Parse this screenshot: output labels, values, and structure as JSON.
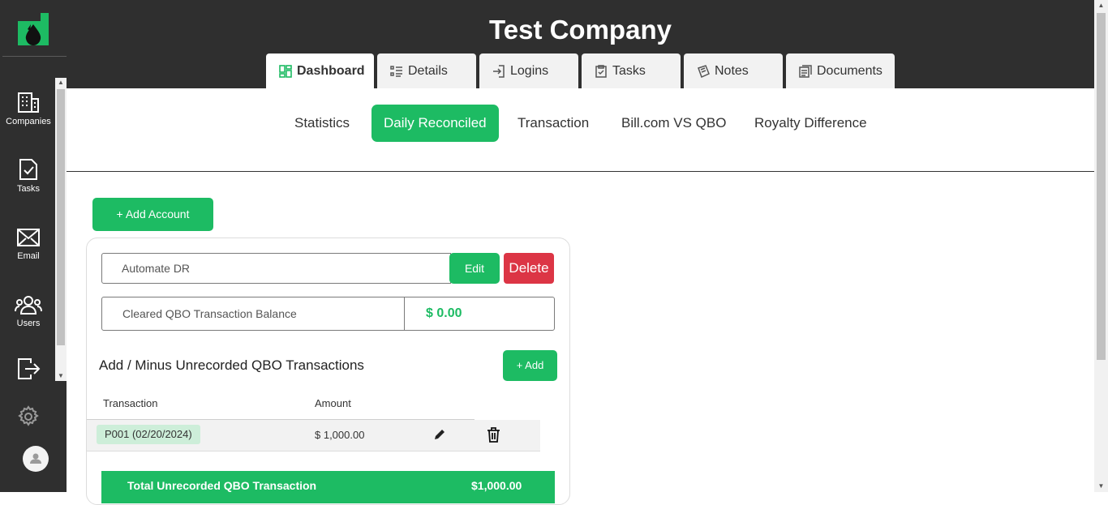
{
  "header": {
    "company_name": "Test Company"
  },
  "tabs": [
    {
      "label": "Dashboard",
      "icon": "dashboard-icon",
      "active": true
    },
    {
      "label": "Details",
      "icon": "list-icon"
    },
    {
      "label": "Logins",
      "icon": "login-icon"
    },
    {
      "label": "Tasks",
      "icon": "clipboard-icon"
    },
    {
      "label": "Notes",
      "icon": "notes-icon"
    },
    {
      "label": "Documents",
      "icon": "documents-icon"
    }
  ],
  "sidebar": {
    "items": [
      {
        "label": "Companies",
        "icon": "building-icon"
      },
      {
        "label": "Tasks",
        "icon": "task-icon"
      },
      {
        "label": "Email",
        "icon": "email-icon"
      },
      {
        "label": "Users",
        "icon": "users-icon"
      },
      {
        "label": "",
        "icon": "logout-icon"
      },
      {
        "label": "",
        "icon": "gear-icon"
      }
    ]
  },
  "subtabs": [
    {
      "label": "Statistics"
    },
    {
      "label": "Daily Reconciled",
      "active": true
    },
    {
      "label": "Transaction"
    },
    {
      "label": "Bill.com VS QBO"
    },
    {
      "label": "Royalty Difference"
    }
  ],
  "actions": {
    "add_account": "+ Add Account"
  },
  "account": {
    "name": "Automate DR",
    "edit": "Edit",
    "delete": "Delete",
    "balance_label": "Cleared QBO Transaction Balance",
    "balance_value": "$ 0.00"
  },
  "unrecorded": {
    "title": "Add / Minus Unrecorded QBO Transactions",
    "add": "+ Add",
    "columns": [
      "Transaction",
      "Amount"
    ],
    "rows": [
      {
        "transaction": "P001 (02/20/2024)",
        "amount": "$ 1,000.00"
      }
    ],
    "total_label": "Total Unrecorded QBO Transaction",
    "total_value": "$1,000.00"
  },
  "colors": {
    "accent": "#1dbb63",
    "danger": "#dc3545",
    "dark": "#2f2f2f"
  }
}
